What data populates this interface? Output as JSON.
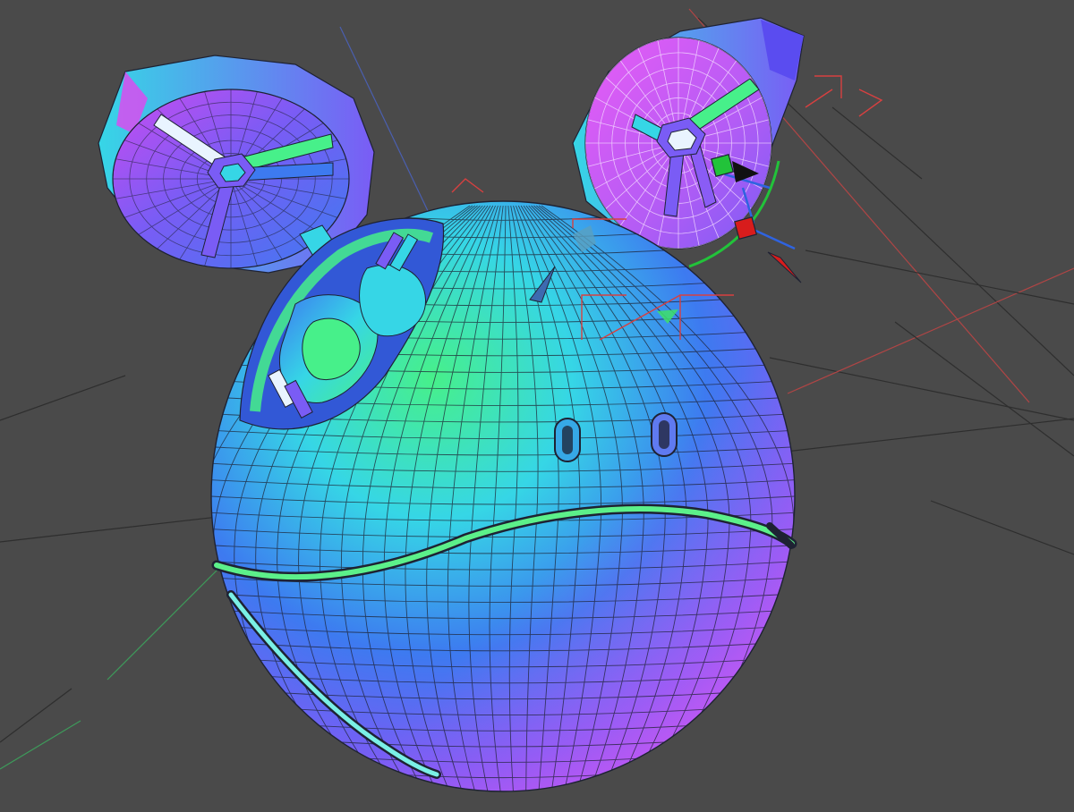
{
  "viewport": {
    "background_color": "#4a4a4a",
    "grid_line_color": "#2e2e2e",
    "axis_x_color": "#b04545",
    "axis_y_color": "#3d9a5a",
    "axis_z_color": "#4a5fb0"
  },
  "model": {
    "palette": {
      "green": "#47f08a",
      "cyan": "#36d6e6",
      "blue": "#3d7af0",
      "violet": "#7a5cf5",
      "magenta": "#c94cf0",
      "pink": "#e85cf5",
      "wire": "#1e2233"
    }
  },
  "gizmo": {
    "x_handle_color": "#d81c1c",
    "y_handle_color": "#22c33a",
    "z_handle_color": "#2f63e0",
    "bracket_color": "#d84040"
  },
  "icons": [
    "move-gizmo-icon"
  ]
}
